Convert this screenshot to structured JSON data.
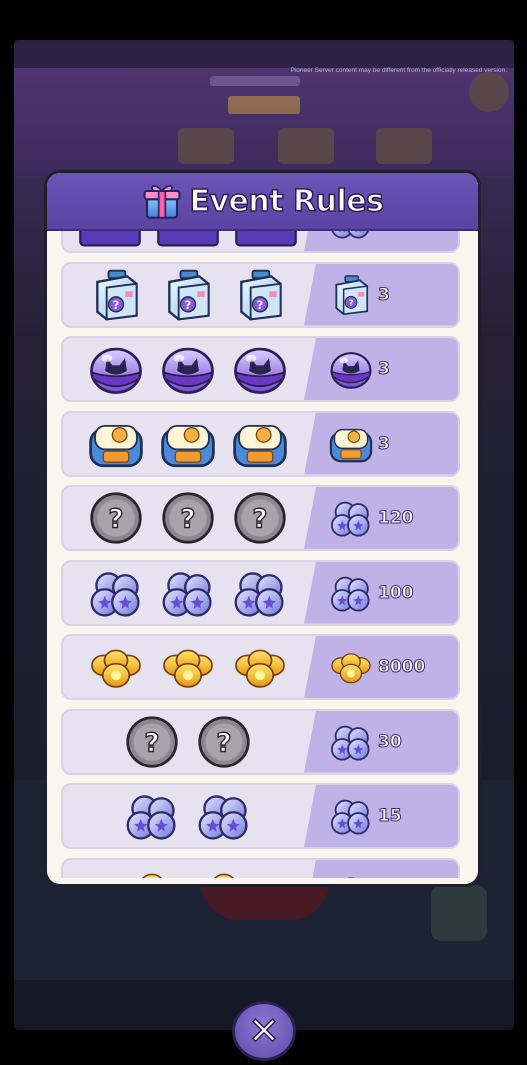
{
  "disclaimer": "Pioneer Server content may be different from the officially released version.",
  "dialog": {
    "title": "Event Rules",
    "title_icon": "gift-icon"
  },
  "rows": [
    {
      "left_icon": "purple-chest-icon",
      "left_count": 3,
      "right_icon": "orb-cluster-icon",
      "quantity": "",
      "partial": "top"
    },
    {
      "left_icon": "mystery-box-icon",
      "left_count": 3,
      "right_icon": "mystery-box-icon",
      "quantity": "3"
    },
    {
      "left_icon": "cat-capsule-icon",
      "left_count": 3,
      "right_icon": "cat-capsule-icon",
      "quantity": "3"
    },
    {
      "left_icon": "cat-bed-icon",
      "left_count": 3,
      "right_icon": "cat-bed-icon",
      "quantity": "3"
    },
    {
      "left_icon": "mystery-coin-icon",
      "left_count": 3,
      "right_icon": "orb-cluster-icon",
      "quantity": "120"
    },
    {
      "left_icon": "orb-cluster-icon",
      "left_count": 3,
      "right_icon": "orb-cluster-icon",
      "quantity": "100"
    },
    {
      "left_icon": "gold-coin-pile-icon",
      "left_count": 3,
      "right_icon": "gold-coin-pile-icon",
      "quantity": "8000"
    },
    {
      "left_icon": "mystery-coin-icon",
      "left_count": 2,
      "right_icon": "orb-cluster-icon",
      "quantity": "30"
    },
    {
      "left_icon": "orb-cluster-icon",
      "left_count": 2,
      "right_icon": "orb-cluster-icon",
      "quantity": "15"
    },
    {
      "left_icon": "gold-coin-pile-icon",
      "left_count": 2,
      "right_icon": "gold-coin-pile-icon",
      "quantity": "",
      "partial": "bottom"
    }
  ],
  "close_button": {
    "icon": "close-icon"
  },
  "colors": {
    "header": "#5b43a3",
    "row_bg": "#e7e2f0",
    "row_right": "#bfb2e6",
    "panel": "#faf6ee"
  }
}
